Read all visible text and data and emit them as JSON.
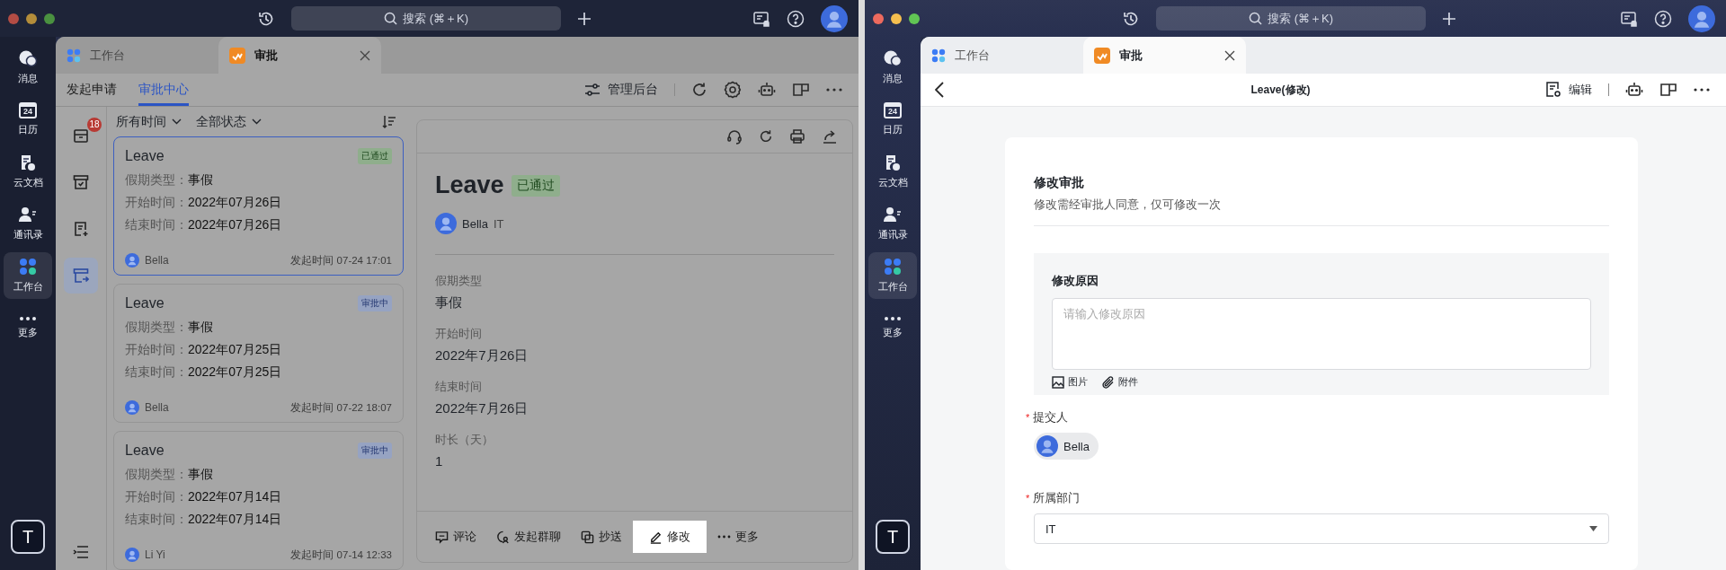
{
  "windows": [
    {
      "kind": "approval_center",
      "dimmed": true,
      "search": {
        "placeholder": "搜索 (⌘＋K)"
      },
      "rail": [
        {
          "kind": "chat",
          "label": "消息",
          "selected": false
        },
        {
          "kind": "calendar",
          "label": "日历",
          "date": "24",
          "selected": false
        },
        {
          "kind": "docs",
          "label": "云文档",
          "selected": false
        },
        {
          "kind": "contacts",
          "label": "通讯录",
          "selected": false
        },
        {
          "kind": "workspace",
          "label": "工作台",
          "selected": true
        },
        {
          "kind": "more",
          "label": "更多",
          "selected": false
        }
      ],
      "profile_initial": "T",
      "tabs": [
        {
          "kind": "workspace",
          "label": "工作台",
          "selected": false
        },
        {
          "kind": "approval",
          "label": "审批",
          "selected": true
        }
      ],
      "nav_tabs": [
        {
          "label": "发起申请",
          "selected": false
        },
        {
          "label": "审批中心",
          "selected": true
        }
      ],
      "admin_link": "管理后台",
      "side_icons": [
        {
          "kind": "pending",
          "badge": "18",
          "selected": false
        },
        {
          "kind": "done",
          "selected": false
        },
        {
          "kind": "submitted",
          "selected": false
        },
        {
          "kind": "cc",
          "selected": true
        }
      ],
      "filters": [
        "所有时间",
        "全部状态"
      ],
      "cards": [
        {
          "title": "Leave",
          "status": {
            "kind": "approved",
            "label": "已通过"
          },
          "selected": true,
          "fields": [
            {
              "label": "假期类型：",
              "value": "事假"
            },
            {
              "label": "开始时间：",
              "value": "2022年07月26日"
            },
            {
              "label": "结束时间：",
              "value": "2022年07月26日"
            }
          ],
          "user": "Bella",
          "time": "发起时间 07-24 17:01"
        },
        {
          "title": "Leave",
          "status": {
            "kind": "pending",
            "label": "审批中"
          },
          "selected": false,
          "fields": [
            {
              "label": "假期类型：",
              "value": "事假"
            },
            {
              "label": "开始时间：",
              "value": "2022年07月25日"
            },
            {
              "label": "结束时间：",
              "value": "2022年07月25日"
            }
          ],
          "user": "Bella",
          "time": "发起时间 07-22 18:07"
        },
        {
          "title": "Leave",
          "status": {
            "kind": "pending",
            "label": "审批中"
          },
          "selected": false,
          "fields": [
            {
              "label": "假期类型：",
              "value": "事假"
            },
            {
              "label": "开始时间：",
              "value": "2022年07月14日"
            },
            {
              "label": "结束时间：",
              "value": "2022年07月14日"
            }
          ],
          "user": "Li Yi",
          "time": "发起时间 07-14 12:33"
        }
      ],
      "detail": {
        "title": "Leave",
        "status": {
          "kind": "approved",
          "label": "已通过"
        },
        "user": "Bella",
        "dept": "IT",
        "fields": [
          {
            "label": "假期类型",
            "value": "事假"
          },
          {
            "label": "开始时间",
            "value": "2022年7月26日"
          },
          {
            "label": "结束时间",
            "value": "2022年7月26日"
          },
          {
            "label": "时长（天）",
            "value": "1"
          }
        ],
        "actions": [
          {
            "kind": "comment",
            "label": "评论",
            "highlighted": false
          },
          {
            "kind": "group_chat",
            "label": "发起群聊",
            "highlighted": false
          },
          {
            "kind": "cc",
            "label": "抄送",
            "highlighted": false
          },
          {
            "kind": "edit",
            "label": "修改",
            "highlighted": true
          },
          {
            "kind": "more",
            "label": "更多",
            "highlighted": false
          }
        ]
      }
    },
    {
      "kind": "edit_form",
      "dimmed": false,
      "search": {
        "placeholder": "搜索 (⌘＋K)"
      },
      "rail": [
        {
          "kind": "chat",
          "label": "消息",
          "selected": false
        },
        {
          "kind": "calendar",
          "label": "日历",
          "date": "24",
          "selected": false
        },
        {
          "kind": "docs",
          "label": "云文档",
          "selected": false
        },
        {
          "kind": "contacts",
          "label": "通讯录",
          "selected": false
        },
        {
          "kind": "workspace",
          "label": "工作台",
          "selected": true
        },
        {
          "kind": "more",
          "label": "更多",
          "selected": false
        }
      ],
      "profile_initial": "T",
      "tabs": [
        {
          "kind": "workspace",
          "label": "工作台",
          "selected": false
        },
        {
          "kind": "approval",
          "label": "审批",
          "selected": true
        }
      ],
      "header_title": "Leave(修改)",
      "edit_label": "编辑",
      "form": {
        "title": "修改审批",
        "subtitle": "修改需经审批人同意，仅可修改一次",
        "reason_label": "修改原因",
        "reason_placeholder": "请输入修改原因",
        "attachments": [
          {
            "kind": "image",
            "label": "图片"
          },
          {
            "kind": "attachment",
            "label": "附件"
          }
        ],
        "fields": [
          {
            "kind": "person",
            "label": "提交人",
            "required_mark": "*",
            "value": "Bella"
          },
          {
            "kind": "select",
            "label": "所属部门",
            "required_mark": "*",
            "value": "IT"
          }
        ]
      }
    }
  ]
}
